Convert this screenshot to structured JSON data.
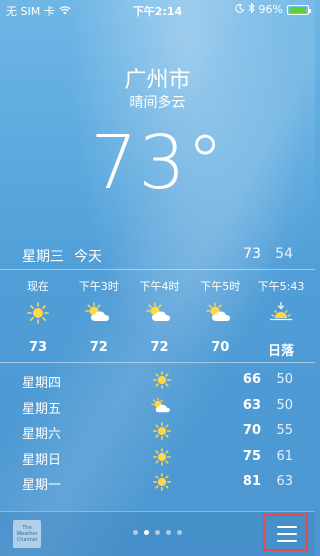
{
  "status_bar": {
    "carrier": "无 SIM 卡",
    "time": "下午2:14",
    "battery": "96%",
    "battery_level": 0.96
  },
  "location": {
    "city": "广州市",
    "condition": "晴间多云",
    "temperature": "73°"
  },
  "today": {
    "day": "星期三",
    "label": "今天",
    "high": "73",
    "low": "54"
  },
  "hourly": [
    {
      "time": "现在",
      "icon": "sun-icon",
      "value": "73"
    },
    {
      "time": "下午3时",
      "icon": "partly-cloudy-icon",
      "value": "72"
    },
    {
      "time": "下午4时",
      "icon": "partly-cloudy-icon",
      "value": "72"
    },
    {
      "time": "下午5时",
      "icon": "partly-cloudy-icon",
      "value": "70"
    },
    {
      "time": "下午5:43",
      "icon": "sunset-icon",
      "value": "日落"
    }
  ],
  "daily": [
    {
      "day": "星期四",
      "icon": "sun-icon",
      "high": "66",
      "low": "50"
    },
    {
      "day": "星期五",
      "icon": "partly-cloudy-icon",
      "high": "63",
      "low": "50"
    },
    {
      "day": "星期六",
      "icon": "sun-icon",
      "high": "70",
      "low": "55"
    },
    {
      "day": "星期日",
      "icon": "sun-icon",
      "high": "75",
      "low": "61"
    },
    {
      "day": "星期一",
      "icon": "sun-icon",
      "high": "81",
      "low": "63"
    }
  ],
  "bottom_bar": {
    "logo_text": "The Weather Channel",
    "page_count": 5,
    "active_page": 1
  },
  "colors": {
    "sun": "#ffd84a",
    "menu_highlight": "#e64a4a",
    "battery": "#58d33d"
  }
}
